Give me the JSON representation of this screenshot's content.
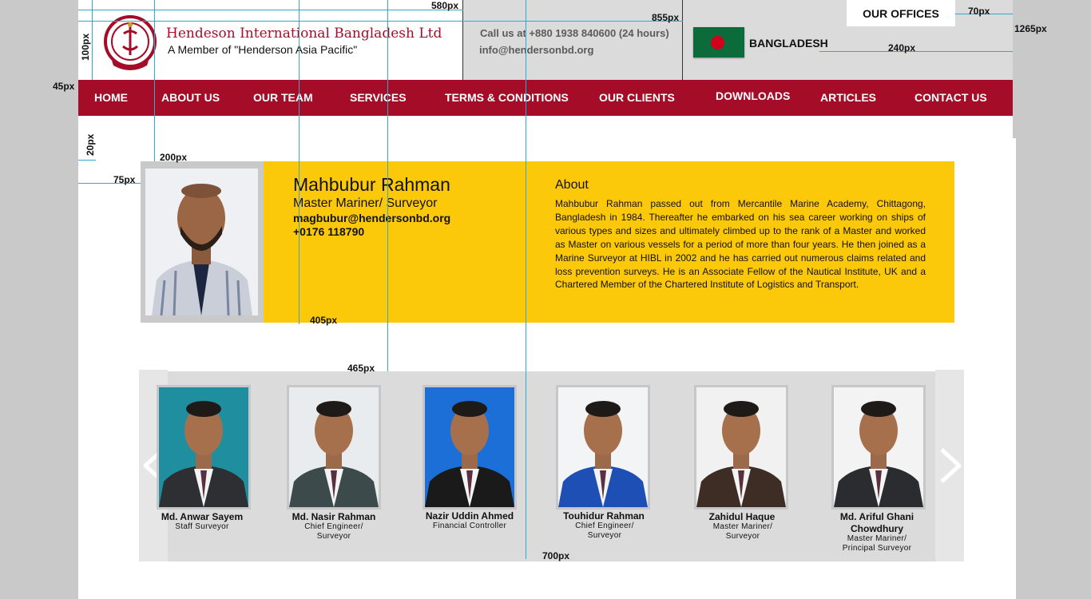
{
  "header": {
    "company_name": "Hendeson International Bangladesh Ltd",
    "tagline": "A Member of \"Henderson Asia Pacific\"",
    "call": "Call us at +880 1938 840600 (24 hours)",
    "email": "info@hendersonbd.org",
    "country": "BANGLADESH",
    "offices_label": "OUR OFFICES"
  },
  "nav": {
    "items": [
      {
        "label": "HOME"
      },
      {
        "label": "ABOUT US"
      },
      {
        "label": "OUR TEAM"
      },
      {
        "label": "SERVICES"
      },
      {
        "label": "TERMS & CONDITIONS"
      },
      {
        "label": "OUR CLIENTS"
      },
      {
        "label": "DOWNLOADS"
      },
      {
        "label": "ARTICLES"
      },
      {
        "label": "CONTACT US"
      }
    ]
  },
  "dimensions": {
    "d580": "580px",
    "d855": "855px",
    "d70": "70px",
    "d1265": "1265px",
    "d100": "100px",
    "d240": "240px",
    "d45": "45px",
    "d20": "20px",
    "d200": "200px",
    "d75": "75px",
    "d405": "405px",
    "d465": "465px",
    "d700": "700px"
  },
  "profile": {
    "name": "Mahbubur Rahman",
    "role": "Master Mariner/ Surveyor",
    "email": "magbubur@hendersonbd.org",
    "phone": "+0176 118790",
    "about_heading": "About",
    "about_text": "Mahbubur Rahman passed out from Mercantile Marine Academy, Chittagong, Bangladesh in 1984. Thereafter he embarked on his sea career working on ships of various types and sizes and ultimately climbed up to the rank of a Master and worked as Master on various vessels for a period of more than four years. He then joined as a Marine Surveyor at HIBL in 2002 and he has carried out numerous claims related and loss prevention surveys. He is an Associate Fellow of the Nautical Institute, UK and a Chartered Member of the Chartered Institute of Logistics and Transport."
  },
  "team": [
    {
      "name": "Md. Anwar Sayem",
      "role": "Staff Surveyor",
      "bg": "#1f8fa0",
      "suit": "#2d2f33"
    },
    {
      "name": "Md. Nasir Rahman",
      "role": "Chief Engineer/ Surveyor",
      "bg": "#e9ecef",
      "suit": "#3d4a4b"
    },
    {
      "name": "Nazir Uddin Ahmed",
      "role": "Financial Controller",
      "bg": "#1b6fd6",
      "suit": "#1a1a1a"
    },
    {
      "name": "Touhidur Rahman",
      "role": "Chief Engineer/ Surveyor",
      "bg": "#f3f4f6",
      "suit": "#1e4fb5"
    },
    {
      "name": "Zahidul Haque",
      "role": "Master Mariner/ Surveyor",
      "bg": "#f1f1f1",
      "suit": "#3d2d24"
    },
    {
      "name": "Md. Ariful Ghani Chowdhury",
      "role": "Master Mariner/ Principal Surveyor",
      "bg": "#f3f3f3",
      "suit": "#2b2c30"
    }
  ],
  "colors": {
    "brand_red": "#a40c27",
    "profile_yellow": "#fcc80a",
    "guide_blue": "#35a8cf"
  }
}
